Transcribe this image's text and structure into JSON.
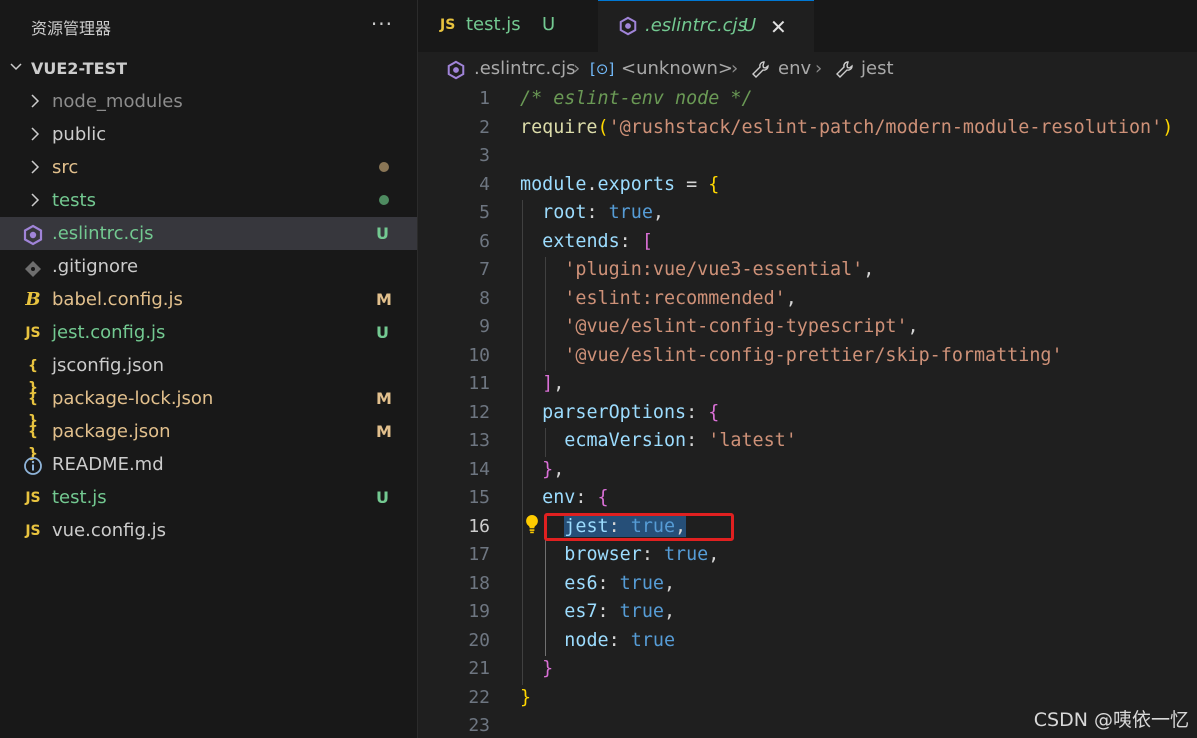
{
  "sidebar": {
    "title": "资源管理器",
    "more": "···",
    "section": "VUE2-TEST",
    "items": [
      {
        "name": "node_modules",
        "type": "folder",
        "color": "#8c8c8c",
        "icon": "chevron-right",
        "status": ""
      },
      {
        "name": "public",
        "type": "folder",
        "color": "#cccccc",
        "icon": "chevron-right",
        "status": ""
      },
      {
        "name": "src",
        "type": "folder",
        "color": "#e2c08d",
        "icon": "chevron-right",
        "status": "dot",
        "statusColor": "#8a7656"
      },
      {
        "name": "tests",
        "type": "folder",
        "color": "#73c991",
        "icon": "chevron-right",
        "status": "dot",
        "statusColor": "#4e8b60"
      },
      {
        "name": ".eslintrc.cjs",
        "type": "file",
        "color": "#73c991",
        "icon": "eslint-icon",
        "status": "U",
        "statusColor": "#73c991",
        "selected": true
      },
      {
        "name": ".gitignore",
        "type": "file",
        "color": "#cccccc",
        "icon": "git-icon",
        "status": ""
      },
      {
        "name": "babel.config.js",
        "type": "file",
        "color": "#e2c08d",
        "icon": "babel-icon",
        "status": "M",
        "statusColor": "#e2c08d"
      },
      {
        "name": "jest.config.js",
        "type": "file",
        "color": "#73c991",
        "icon": "js-icon",
        "status": "U",
        "statusColor": "#73c991"
      },
      {
        "name": "jsconfig.json",
        "type": "file",
        "color": "#cccccc",
        "icon": "json-icon",
        "status": ""
      },
      {
        "name": "package-lock.json",
        "type": "file",
        "color": "#e2c08d",
        "icon": "json-icon",
        "status": "M",
        "statusColor": "#e2c08d"
      },
      {
        "name": "package.json",
        "type": "file",
        "color": "#e2c08d",
        "icon": "json-icon",
        "status": "M",
        "statusColor": "#e2c08d"
      },
      {
        "name": "README.md",
        "type": "file",
        "color": "#cccccc",
        "icon": "info-icon",
        "status": ""
      },
      {
        "name": "test.js",
        "type": "file",
        "color": "#73c991",
        "icon": "js-icon",
        "status": "U",
        "statusColor": "#73c991"
      },
      {
        "name": "vue.config.js",
        "type": "file",
        "color": "#cccccc",
        "icon": "js-icon",
        "status": ""
      }
    ]
  },
  "icons": {
    "js": "JS",
    "json": "{ }",
    "babel": "B"
  },
  "tabs": [
    {
      "icon": "JS",
      "name": "test.js",
      "badge": "U",
      "active": false
    },
    {
      "icon": "eslint",
      "name": ".eslintrc.cjs",
      "badge": "U",
      "active": true,
      "close": "✕"
    }
  ],
  "breadcrumb": {
    "file": ".eslintrc.cjs",
    "sep": "›",
    "symbol1_icon": "[⊙]",
    "symbol1": "<unknown>",
    "symbol2": "env",
    "symbol3": "jest"
  },
  "editor": {
    "current_line": 16,
    "lines": [
      {
        "n": "1"
      },
      {
        "n": "2"
      },
      {
        "n": "3"
      },
      {
        "n": "4"
      },
      {
        "n": "5"
      },
      {
        "n": "6"
      },
      {
        "n": "7"
      },
      {
        "n": "8"
      },
      {
        "n": "9"
      },
      {
        "n": "10"
      },
      {
        "n": "11"
      },
      {
        "n": "12"
      },
      {
        "n": "13"
      },
      {
        "n": "14"
      },
      {
        "n": "15"
      },
      {
        "n": "16"
      },
      {
        "n": "17"
      },
      {
        "n": "18"
      },
      {
        "n": "19"
      },
      {
        "n": "20"
      },
      {
        "n": "21"
      },
      {
        "n": "22"
      },
      {
        "n": "23"
      }
    ],
    "code": {
      "l1": "/* eslint-env node */",
      "l2_fn": "require",
      "l2_str": "'@rushstack/eslint-patch/modern-module-resolution'",
      "l4_a": "module",
      "l4_b": ".",
      "l4_c": "exports",
      "l4_d": " = ",
      "root": "root",
      "true": "true",
      "extends": "extends",
      "s7": "'plugin:vue/vue3-essential'",
      "s8": "'eslint:recommended'",
      "s9": "'@vue/eslint-config-typescript'",
      "s10": "'@vue/eslint-config-prettier/skip-formatting'",
      "parserOptions": "parserOptions",
      "ecmaVersion": "ecmaVersion",
      "latest": "'latest'",
      "env": "env",
      "jest": "jest",
      "browser": "browser",
      "es6": "es6",
      "es7": "es7",
      "node": "node"
    }
  },
  "watermark": "CSDN @咦依一忆"
}
